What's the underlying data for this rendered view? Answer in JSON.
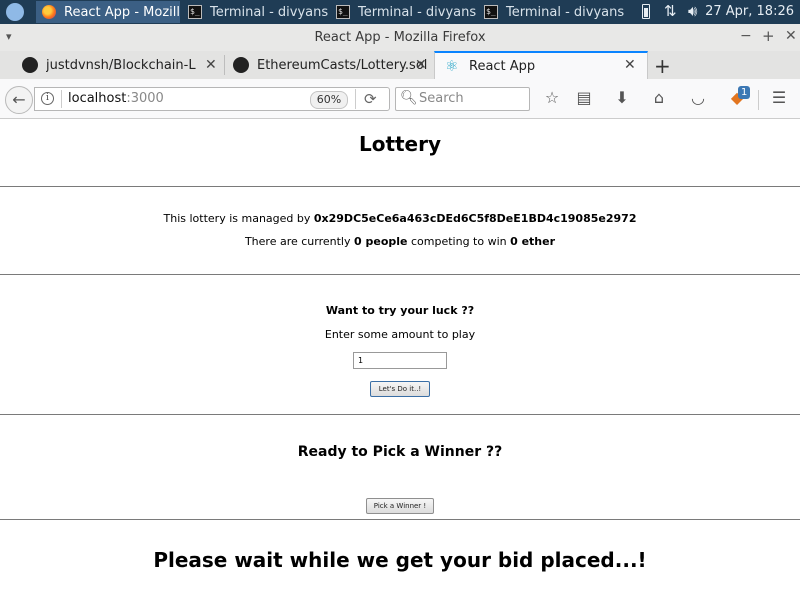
{
  "taskbar": {
    "tasks": [
      {
        "label": "React App - Mozilla...",
        "icon": "firefox-icon",
        "active": true
      },
      {
        "label": "Terminal - divyans...",
        "icon": "terminal-icon"
      },
      {
        "label": "Terminal - divyans...",
        "icon": "terminal-icon"
      },
      {
        "label": "Terminal - divyans...",
        "icon": "terminal-icon"
      }
    ],
    "clock": "27 Apr, 18:26"
  },
  "window": {
    "title": "React App - Mozilla Firefox"
  },
  "tabs": [
    {
      "label": "justdvnsh/Blockchain-Lottery",
      "icon": "github-icon"
    },
    {
      "label": "EthereumCasts/Lottery.sol",
      "icon": "github-icon"
    },
    {
      "label": "React App",
      "icon": "react-icon",
      "active": true
    }
  ],
  "navbar": {
    "url_host": "localhost",
    "url_port": ":3000",
    "zoom": "60%",
    "search_placeholder": "Search",
    "extension_badge": "1"
  },
  "page": {
    "title": "Lottery",
    "manager_prefix": "This lottery is managed by ",
    "manager_address": "0x29DC5eCe6a463cDEd6C5f8DeE1BD4c19085e2972",
    "players_prefix": "There are currently ",
    "players_count": "0 people",
    "players_middle": " competing to win ",
    "pot": "0 ether",
    "luck_heading": "Want to try your luck ??",
    "amount_label": "Enter some amount to play",
    "amount_value": "1",
    "enter_button": "Let's Do it..!",
    "winner_heading": "Ready to Pick a Winner ??",
    "pick_button": "Pick a Winner !",
    "status_message": "Please wait while we get your bid placed...!"
  }
}
